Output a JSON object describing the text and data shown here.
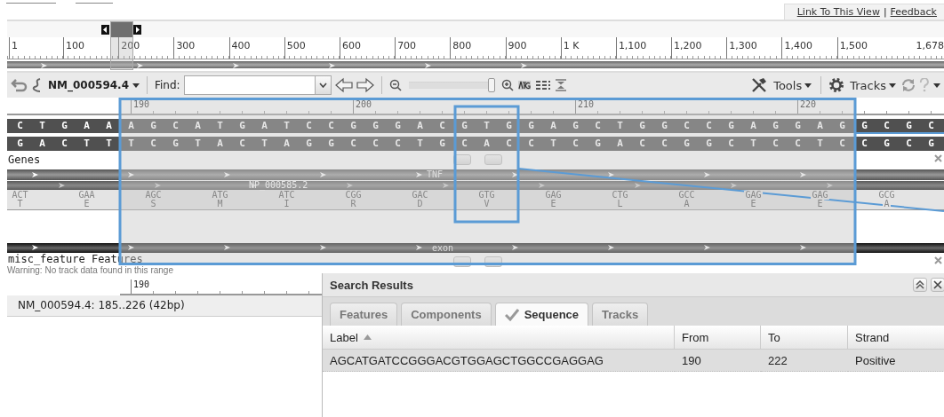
{
  "header": {
    "links": [
      {
        "label": "Link To This View"
      },
      {
        "label": "Feedback"
      }
    ],
    "separator": "|"
  },
  "overview": {
    "ruler_labels": [
      "1",
      "100",
      "200",
      "300",
      "400",
      "500",
      "600",
      "700",
      "800",
      "900",
      "1 K",
      "1,100",
      "1,200",
      "1,300",
      "1,400",
      "1,500"
    ],
    "end_label": "1,678"
  },
  "toolbar": {
    "sequence": "NM_000594.4",
    "find_label": "Find:",
    "zoom": {
      "level": 0.97
    },
    "tools": "Tools",
    "tracks": "Tracks"
  },
  "detail": {
    "ruler_labels": [
      "190",
      "200",
      "210",
      "220"
    ],
    "forward": [
      "C",
      "T",
      "G",
      "A",
      "A",
      "A",
      "G",
      "C",
      "A",
      "T",
      "G",
      "A",
      "T",
      "C",
      "C",
      "G",
      "G",
      "G",
      "A",
      "C",
      "G",
      "T",
      "G",
      "G",
      "A",
      "G",
      "C",
      "T",
      "G",
      "G",
      "C",
      "C",
      "G",
      "A",
      "G",
      "G",
      "A",
      "G",
      "G",
      "C",
      "G",
      "C"
    ],
    "reverse": [
      "G",
      "A",
      "C",
      "T",
      "T",
      "T",
      "C",
      "G",
      "T",
      "A",
      "C",
      "T",
      "A",
      "G",
      "G",
      "C",
      "C",
      "C",
      "T",
      "G",
      "C",
      "A",
      "C",
      "C",
      "T",
      "C",
      "G",
      "A",
      "C",
      "C",
      "G",
      "G",
      "C",
      "T",
      "C",
      "C",
      "T",
      "C",
      "C",
      "G",
      "C",
      "G"
    ],
    "tracks": [
      {
        "kind": "genes",
        "title": "Genes",
        "gene_label": "TNF",
        "protein_label": "NP_000585.2",
        "codons": [
          {
            "codon": "ACT",
            "aa": "T"
          },
          {
            "codon": "GAA",
            "aa": "E"
          },
          {
            "codon": "AGC",
            "aa": "S"
          },
          {
            "codon": "ATG",
            "aa": "M"
          },
          {
            "codon": "ATC",
            "aa": "I"
          },
          {
            "codon": "CGG",
            "aa": "R"
          },
          {
            "codon": "GAC",
            "aa": "D"
          },
          {
            "codon": "GTG",
            "aa": "V"
          },
          {
            "codon": "GAG",
            "aa": "E"
          },
          {
            "codon": "CTG",
            "aa": "L"
          },
          {
            "codon": "GCC",
            "aa": "A"
          },
          {
            "codon": "GAG",
            "aa": "E"
          },
          {
            "codon": "GAG",
            "aa": "E"
          },
          {
            "codon": "GCG",
            "aa": "A"
          }
        ]
      },
      {
        "kind": "features",
        "title": "misc_feature Features",
        "feature_label": "exon",
        "warning": "Warning: No track data found in this range"
      }
    ],
    "bottom_ruler_label": "190"
  },
  "status": "NM_000594.4: 185..226 (42bp)",
  "search_results": {
    "title": "Search Results",
    "tabs": [
      {
        "label": "Features",
        "selected": false
      },
      {
        "label": "Components",
        "selected": false
      },
      {
        "label": "Sequence",
        "selected": true
      },
      {
        "label": "Tracks",
        "selected": false
      }
    ],
    "columns": [
      {
        "label": "Label",
        "sorted": true
      },
      {
        "label": "From",
        "sorted": false
      },
      {
        "label": "To",
        "sorted": false
      },
      {
        "label": "Strand",
        "sorted": false
      }
    ],
    "rows": [
      {
        "cells": [
          "AGCATGATCCGGGACGTGGAGCTGGCCGAGGAG",
          "190",
          "222",
          "Positive"
        ],
        "selected": true
      }
    ]
  }
}
